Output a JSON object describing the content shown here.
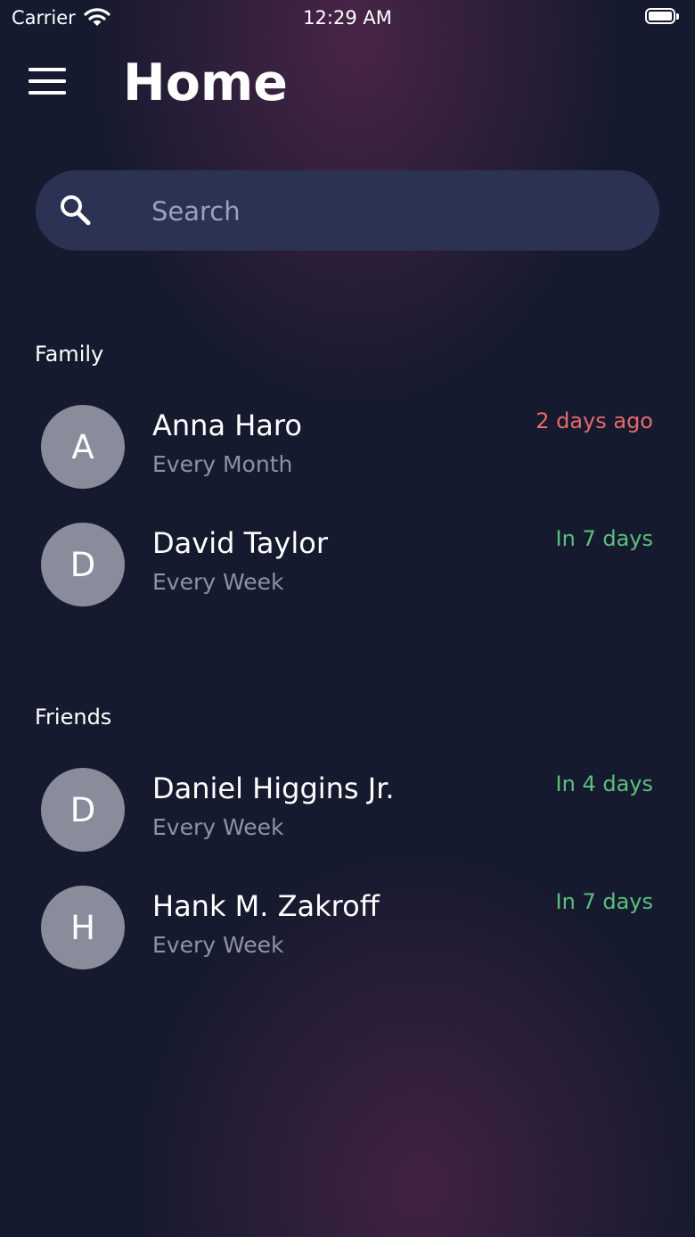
{
  "status_bar": {
    "carrier": "Carrier",
    "time": "12:29 AM"
  },
  "header": {
    "title": "Home",
    "menu_icon": "hamburger-menu-icon"
  },
  "search": {
    "placeholder": "Search",
    "value": "",
    "icon": "search-icon"
  },
  "sections": [
    {
      "title": "Family",
      "contacts": [
        {
          "initial": "A",
          "name": "Anna Haro",
          "frequency": "Every Month",
          "due": "2 days ago",
          "status": "overdue"
        },
        {
          "initial": "D",
          "name": "David Taylor",
          "frequency": "Every Week",
          "due": "In 7 days",
          "status": "upcoming"
        }
      ]
    },
    {
      "title": "Friends",
      "contacts": [
        {
          "initial": "D",
          "name": "Daniel Higgins Jr.",
          "frequency": "Every Week",
          "due": "In 4 days",
          "status": "upcoming"
        },
        {
          "initial": "H",
          "name": "Hank M. Zakroff",
          "frequency": "Every Week",
          "due": "In 7 days",
          "status": "upcoming"
        }
      ]
    }
  ],
  "colors": {
    "background": "#161a2e",
    "search_field": "#2c3253",
    "avatar": "#8a8c9c",
    "overdue": "#e8696a",
    "upcoming": "#5dbf7f",
    "secondary_text": "#8e91a8"
  }
}
